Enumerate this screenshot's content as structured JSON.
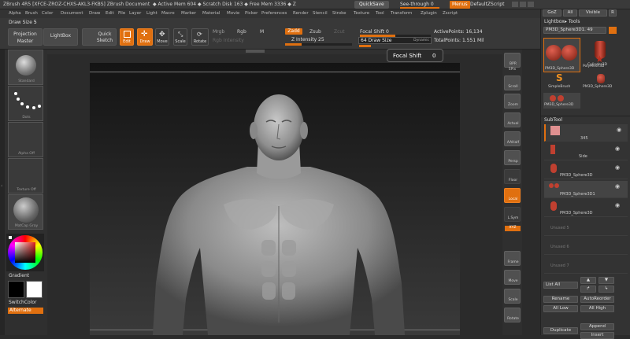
{
  "titlebar": {
    "app": "ZBrush 4R5",
    "doc_id": "[XFCE-ZROZ-CHXS-AKL3-FKBS]",
    "doc": "ZBrush Document",
    "active_mem": "Active Mem 604",
    "scratch_disk": "Scratch Disk 163",
    "free_mem": "Free Mem 3336",
    "truncated": "Z",
    "quicksave": "QuickSave",
    "see_through": "See-through",
    "see_through_value": "0",
    "menus": "Menus",
    "default_zscript": "DefaultZScript"
  },
  "menubar": {
    "items": [
      "Alpha",
      "Brush",
      "Color",
      "Document",
      "Draw",
      "Edit",
      "File",
      "Layer",
      "Light",
      "Macro",
      "Marker",
      "Material",
      "Movie",
      "Picker",
      "Preferences",
      "Render",
      "Stencil",
      "Stroke",
      "Texture",
      "Tool",
      "Transform",
      "Zplugin",
      "Zscript"
    ]
  },
  "toolbar": {
    "draw_size_label": "Draw Size",
    "draw_size_value": "5",
    "projection_master": "Projection Master",
    "lightbox": "LightBox",
    "quick_sketch": "Quick Sketch",
    "edit": "Edit",
    "draw": "Draw",
    "move": "Move",
    "scale": "Scale",
    "rotate": "Rotate",
    "mrgb": "Mrgb",
    "rgb": "Rgb",
    "m": "M",
    "rgb_intensity": "Rgb Intensity",
    "zadd": "Zadd",
    "zsub": "Zsub",
    "zcut": "Zcut",
    "z_intensity": "Z Intensity 25",
    "focal_shift": "Focal Shift 0",
    "draw_size": "64 Draw Size",
    "dynamic": "Dynamic",
    "active_points": "ActivePoints: 16,134",
    "total_points": "TotalPoints: 1.551 Mil"
  },
  "tooltip": {
    "label": "Focal Shift",
    "value": "0"
  },
  "leftshelf": {
    "standard": "Standard",
    "dots": "Dots",
    "alpha": "Alpha Off",
    "texture": "Texture Off",
    "matcap": "MatCap Gray",
    "gradient": "Gradient",
    "switch_color": "SwitchColor",
    "alternate": "Alternate"
  },
  "rightshelf": {
    "items": [
      "BPR",
      "SPix",
      "Scroll",
      "Zoom",
      "Actual",
      "AAHalf",
      "Persp",
      "Floor",
      "Local",
      "L.Sym",
      "XYZ",
      "Frame",
      "Move",
      "Scale",
      "Rotate"
    ]
  },
  "tray": {
    "goz": "GoZ",
    "all": "All",
    "visible": "Visible",
    "r": "R",
    "lightbox_tools": "Lightbox▸ Tools",
    "current_tool": "PM3D_Sphere3D1. 49",
    "tools": [
      "PM3D_Sphere3D",
      "Cylinder3D",
      "PolyMesh3D",
      "SimpleBrush",
      "PM3D_Sphere3D",
      "PM3D_Sphere3D"
    ],
    "subtool_header": "SubTool",
    "subtools": [
      "345",
      "Side",
      "PM3D_Sphere3D",
      "PM3D_Sphere3D1",
      "PM3D_Sphere3D",
      "Unused 5",
      "Unused 6",
      "Unused 7"
    ],
    "list_all": "List All",
    "rename": "Rename",
    "auto_reorder": "AutoReorder",
    "all_low": "All Low",
    "all_high": "All High",
    "append": "Append",
    "duplicate": "Duplicate",
    "insert": "Insert"
  },
  "colors": {
    "accent": "#e07010",
    "background": "#2b2b2b",
    "panel": "#333333"
  }
}
